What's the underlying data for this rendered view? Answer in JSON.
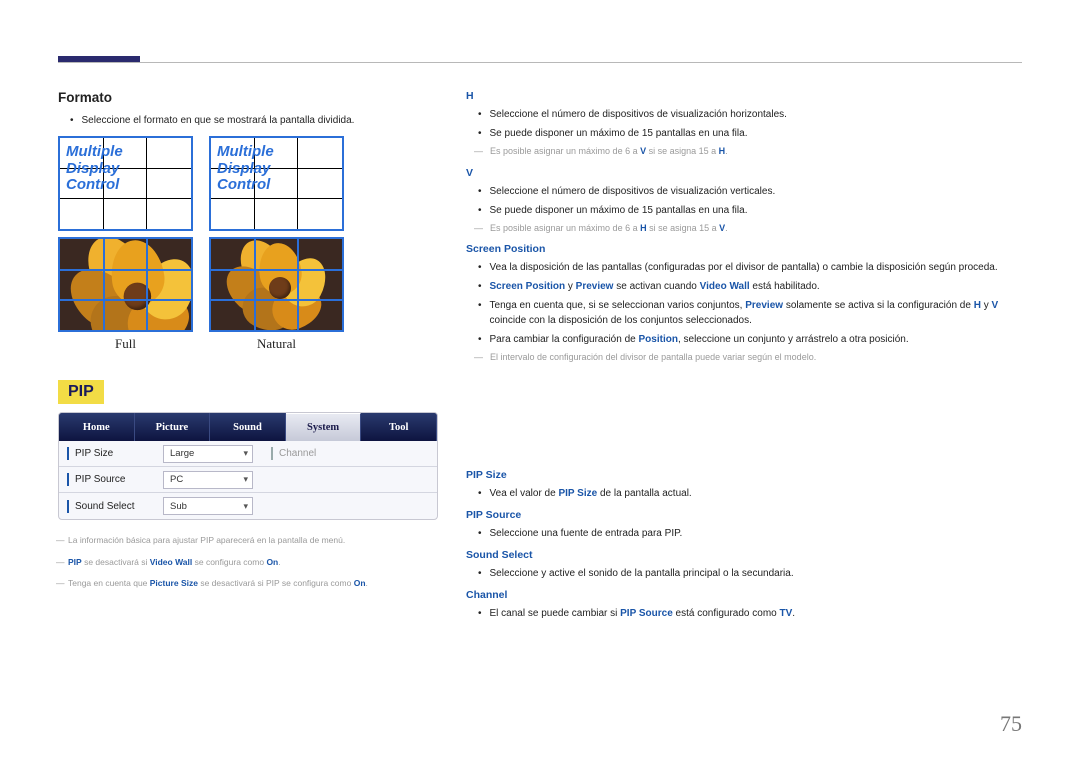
{
  "page_number": "75",
  "left": {
    "formato_heading": "Formato",
    "formato_bullet": "Seleccione el formato en que se mostrará la pantalla dividida.",
    "mdc_text": "Multiple\nDisplay\nControl",
    "label_full": "Full",
    "label_natural": "Natural",
    "pip_badge": "PIP",
    "menu": {
      "tabs": [
        "Home",
        "Picture",
        "Sound",
        "System",
        "Tool"
      ],
      "active_tab": "System",
      "rows": [
        {
          "label": "PIP Size",
          "value": "Large",
          "extra_label": "Channel"
        },
        {
          "label": "PIP Source",
          "value": "PC"
        },
        {
          "label": "Sound Select",
          "value": "Sub"
        }
      ]
    },
    "notes": {
      "n1": "La información básica para ajustar PIP aparecerá en la pantalla de menú.",
      "n2_a": "PIP",
      "n2_b": " se desactivará si ",
      "n2_c": "Video Wall",
      "n2_d": " se configura como ",
      "n2_e": "On",
      "n2_f": ".",
      "n3_a": "Tenga en cuenta que ",
      "n3_b": "Picture Size",
      "n3_c": " se desactivará si PIP se configura como ",
      "n3_d": "On",
      "n3_e": "."
    }
  },
  "right": {
    "h_head": "H",
    "h_b1": "Seleccione el número de dispositivos de visualización horizontales.",
    "h_b2": "Se puede disponer un máximo de 15 pantallas en una fila.",
    "h_note_a": "Es posible asignar un máximo de 6 a ",
    "h_note_b": "V",
    "h_note_c": " si se asigna 15 a ",
    "h_note_d": "H",
    "h_note_e": ".",
    "v_head": "V",
    "v_b1": "Seleccione el número de dispositivos de visualización verticales.",
    "v_b2": "Se puede disponer un máximo de 15 pantallas en una fila.",
    "v_note_a": "Es posible asignar un máximo de 6 a ",
    "v_note_b": "H",
    "v_note_c": " si se asigna 15 a ",
    "v_note_d": "V",
    "v_note_e": ".",
    "sp_head": "Screen Position",
    "sp_b1": "Vea la disposición de las pantallas (configuradas por el divisor de pantalla) o cambie la disposición según proceda.",
    "sp_b2_a": "Screen Position",
    "sp_b2_b": " y ",
    "sp_b2_c": "Preview",
    "sp_b2_d": " se activan cuando ",
    "sp_b2_e": "Video Wall",
    "sp_b2_f": " está habilitado.",
    "sp_b3_a": "Tenga en cuenta que, si se seleccionan varios conjuntos, ",
    "sp_b3_b": "Preview",
    "sp_b3_c": " solamente se activa si la configuración de ",
    "sp_b3_d": "H",
    "sp_b3_e": " y ",
    "sp_b3_f": "V",
    "sp_b3_g": " coincide con la disposición de los conjuntos seleccionados.",
    "sp_b4_a": "Para cambiar la configuración de ",
    "sp_b4_b": "Position",
    "sp_b4_c": ", seleccione un conjunto y arrástrelo a otra posición.",
    "sp_note": "El intervalo de configuración del divisor de pantalla puede variar según el modelo.",
    "psize_head": "PIP Size",
    "psize_b_a": "Vea el valor de ",
    "psize_b_b": "PIP Size",
    "psize_b_c": " de la pantalla actual.",
    "psrc_head": "PIP Source",
    "psrc_b": "Seleccione una fuente de entrada para PIP.",
    "ssel_head": "Sound Select",
    "ssel_b": "Seleccione y active el sonido de la pantalla principal o la secundaria.",
    "chan_head": "Channel",
    "chan_b_a": "El canal se puede cambiar si ",
    "chan_b_b": "PIP Source",
    "chan_b_c": " está configurado como ",
    "chan_b_d": "TV",
    "chan_b_e": "."
  }
}
